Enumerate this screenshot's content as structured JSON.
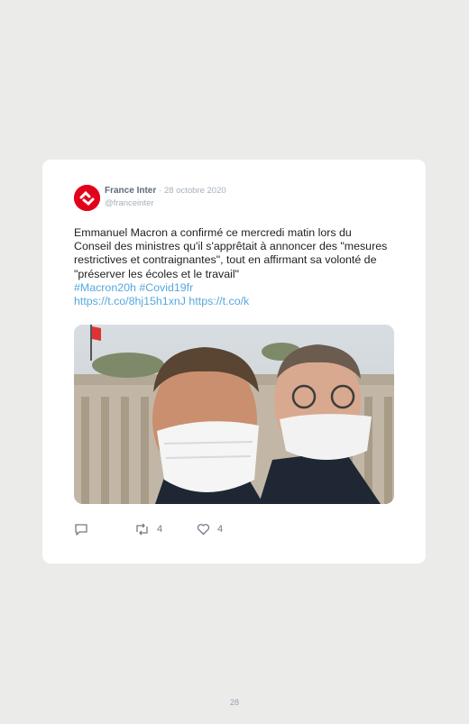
{
  "tweet": {
    "author_name": "France Inter",
    "separator": "·",
    "date": "28 octobre 2020",
    "handle": "@franceinter",
    "body": "Emmanuel Macron a confirmé ce mercredi matin lors du Conseil des ministres qu'il s'apprêtait à annoncer des \"mesures restrictives et contraignantes\", tout en affirmant sa volonté de \"préserver les écoles et le travail\"",
    "hashtags": "#Macron20h #Covid19fr",
    "links": "https://t.co/8hj15h1xnJ https://t.co/k",
    "retweets": "4",
    "likes": "4"
  },
  "icons": {
    "avatar": "france-inter-logo",
    "reply": "reply-icon",
    "retweet": "retweet-icon",
    "like": "heart-icon"
  },
  "colors": {
    "background": "#ebebea",
    "card": "#ffffff",
    "link": "#56a8df",
    "brand": "#e3001b"
  },
  "page": {
    "number": "28"
  }
}
